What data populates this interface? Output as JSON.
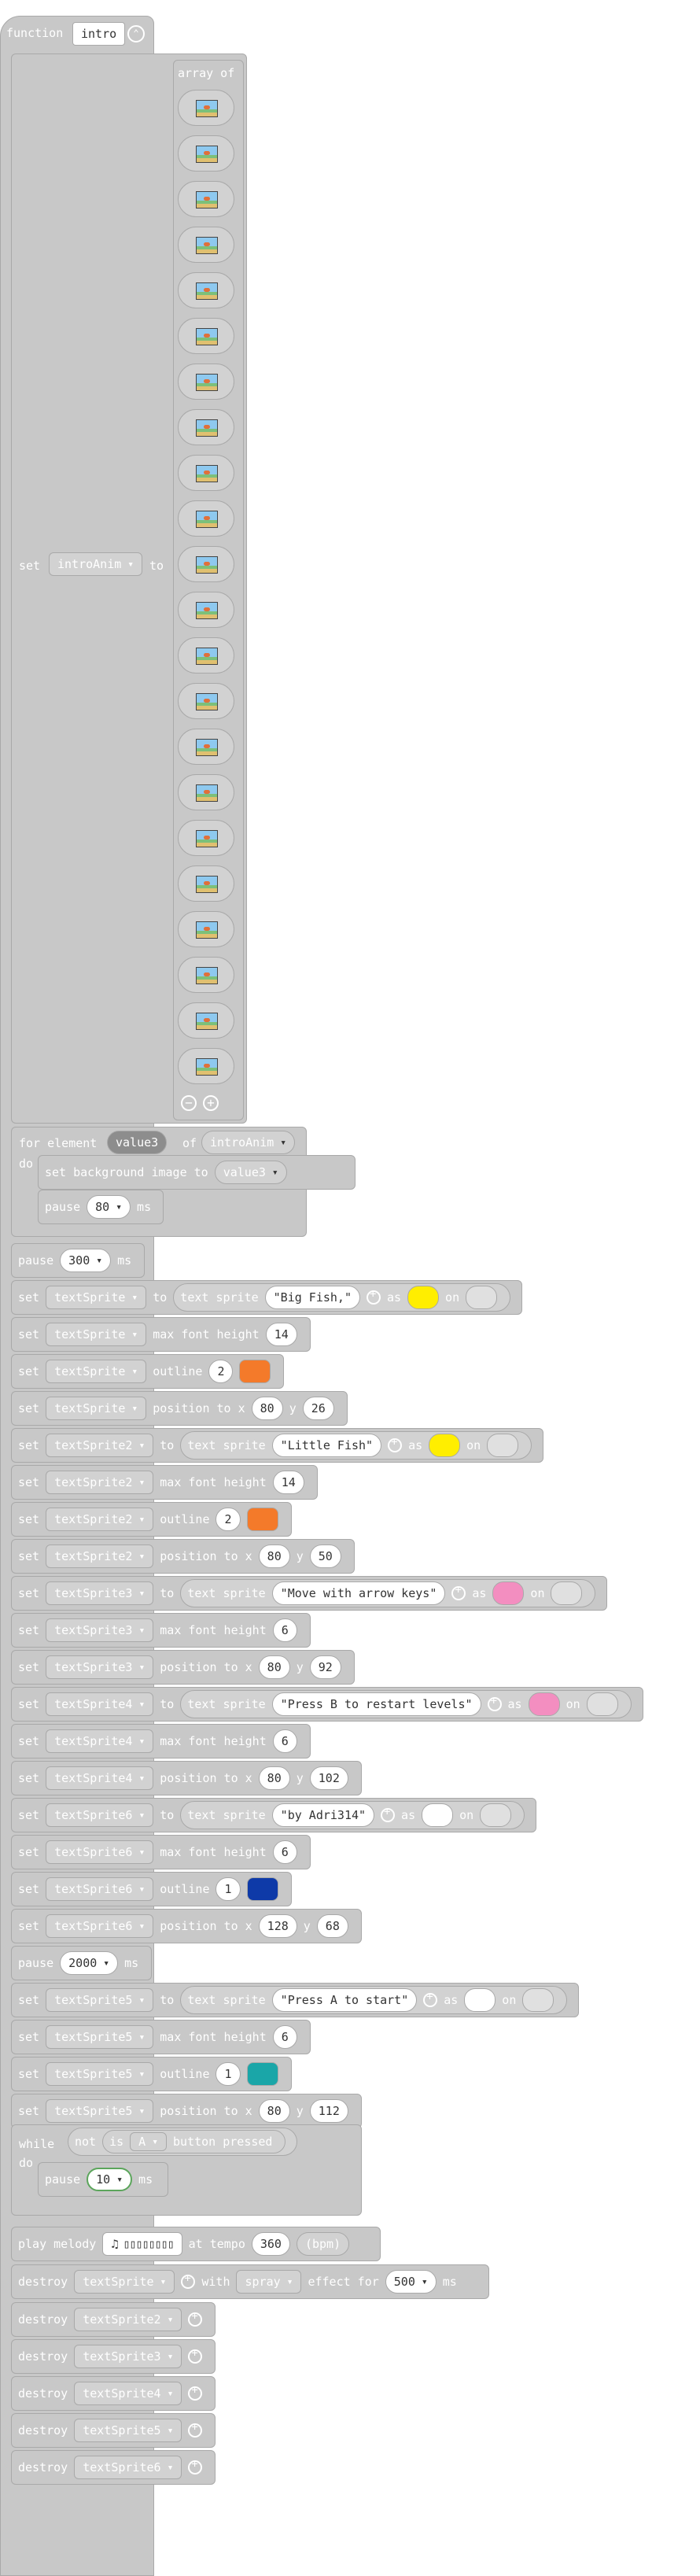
{
  "function": {
    "keyword": "function",
    "name": "intro"
  },
  "set_anim": {
    "keyword": "set",
    "var": "introAnim",
    "to": "to",
    "array_label": "array of",
    "image_count": 22
  },
  "for_loop": {
    "prefix": "for element",
    "item": "value3",
    "of": "of",
    "list": "introAnim",
    "do": "do",
    "set_bg": "set background image to",
    "bg_var": "value3",
    "pause": "pause",
    "pause_ms": "80",
    "ms": "ms"
  },
  "rows": [
    {
      "kind": "pause",
      "label": "pause",
      "value": "300",
      "unit": "ms"
    },
    {
      "kind": "text",
      "var": "textSprite",
      "text": "\"Big Fish,\"",
      "fg": "#ffee00",
      "bg": "#e0e0e0"
    },
    {
      "kind": "prop",
      "var": "textSprite",
      "prop": "max font height",
      "value": "14"
    },
    {
      "kind": "outline",
      "var": "textSprite",
      "value": "2",
      "color": "#f47a2a"
    },
    {
      "kind": "pos",
      "var": "textSprite",
      "x": "80",
      "y": "26"
    },
    {
      "kind": "text",
      "var": "textSprite2",
      "text": "\"Little Fish\"",
      "fg": "#ffee00",
      "bg": "#e0e0e0"
    },
    {
      "kind": "prop",
      "var": "textSprite2",
      "prop": "max font height",
      "value": "14"
    },
    {
      "kind": "outline",
      "var": "textSprite2",
      "value": "2",
      "color": "#f47a2a"
    },
    {
      "kind": "pos",
      "var": "textSprite2",
      "x": "80",
      "y": "50"
    },
    {
      "kind": "text",
      "var": "textSprite3",
      "text": "\"Move with arrow keys\"",
      "fg": "#f38ec0",
      "bg": "#e0e0e0"
    },
    {
      "kind": "prop",
      "var": "textSprite3",
      "prop": "max font height",
      "value": "6"
    },
    {
      "kind": "pos",
      "var": "textSprite3",
      "x": "80",
      "y": "92"
    },
    {
      "kind": "text",
      "var": "textSprite4",
      "text": "\"Press B to restart levels\"",
      "fg": "#f38ec0",
      "bg": "#e0e0e0"
    },
    {
      "kind": "prop",
      "var": "textSprite4",
      "prop": "max font height",
      "value": "6"
    },
    {
      "kind": "pos",
      "var": "textSprite4",
      "x": "80",
      "y": "102"
    },
    {
      "kind": "text",
      "var": "textSprite6",
      "text": "\"by Adri314\"",
      "fg": "#ffffff",
      "bg": "#e0e0e0"
    },
    {
      "kind": "prop",
      "var": "textSprite6",
      "prop": "max font height",
      "value": "6"
    },
    {
      "kind": "outline",
      "var": "textSprite6",
      "value": "1",
      "color": "#0e3aa8"
    },
    {
      "kind": "pos",
      "var": "textSprite6",
      "x": "128",
      "y": "68"
    },
    {
      "kind": "pause",
      "label": "pause",
      "value": "2000",
      "unit": "ms"
    },
    {
      "kind": "text",
      "var": "textSprite5",
      "text": "\"Press A to start\"",
      "fg": "#ffffff",
      "bg": "#e0e0e0"
    },
    {
      "kind": "prop",
      "var": "textSprite5",
      "prop": "max font height",
      "value": "6"
    },
    {
      "kind": "outline",
      "var": "textSprite5",
      "value": "1",
      "color": "#1aa6a8"
    },
    {
      "kind": "pos",
      "var": "textSprite5",
      "x": "80",
      "y": "112"
    }
  ],
  "labels": {
    "set": "set",
    "to": "to",
    "text_sprite": "text sprite",
    "as": "as",
    "on": "on",
    "outline": "outline",
    "position_to": "position to x",
    "y": "y",
    "max_font": "max font height"
  },
  "while": {
    "keyword": "while",
    "not": "not",
    "is": "is",
    "button": "A",
    "pressed": "button pressed",
    "do": "do",
    "pause": "pause",
    "pause_ms": "10",
    "ms": "ms"
  },
  "melody": {
    "label": "play melody",
    "at_tempo": "at tempo",
    "tempo": "360",
    "bpm": "(bpm)"
  },
  "destroy_first": {
    "label": "destroy",
    "var": "textSprite",
    "with": "with",
    "effect": "spray",
    "effect_for": "effect for",
    "duration": "500",
    "ms": "ms"
  },
  "destroys": [
    "textSprite2",
    "textSprite3",
    "textSprite4",
    "textSprite5",
    "textSprite6"
  ],
  "destroy_label": "destroy"
}
